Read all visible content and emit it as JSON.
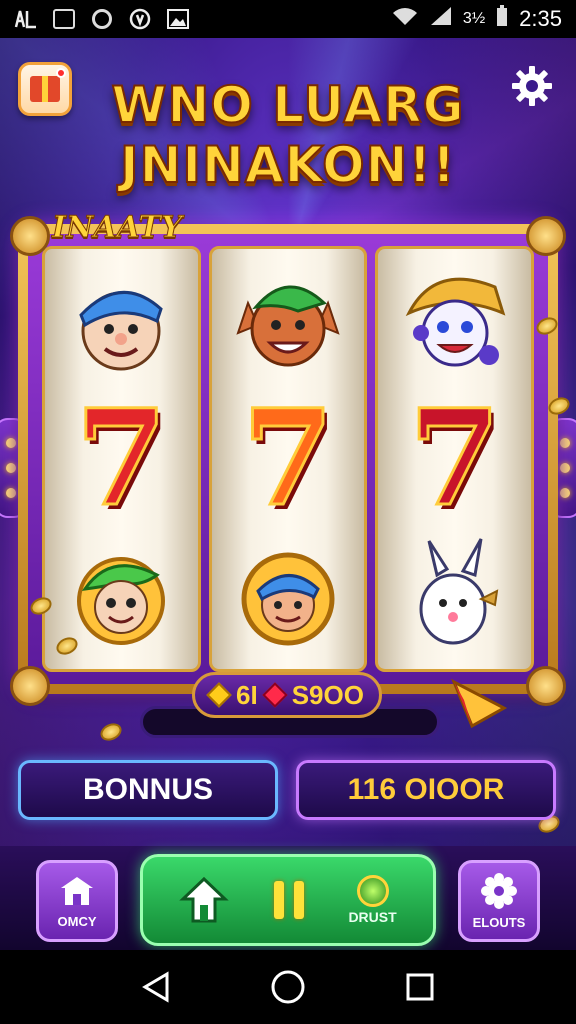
{
  "status_bar": {
    "left_icons": [
      "notification-icon",
      "gallery-icon",
      "circle-icon",
      "at-icon",
      "image-icon"
    ],
    "battery": "3½",
    "time": "2:35"
  },
  "header": {
    "title_line1": "WNO LUARG",
    "title_line2": "JNINAKON!!",
    "gift_icon": "gift-icon",
    "settings_icon": "gear-icon"
  },
  "machine": {
    "frame_label": "INAATY",
    "reels": [
      [
        "cap-face-symbol",
        "seven-symbol",
        "leaf-face-symbol"
      ],
      [
        "elf-face-symbol",
        "seven-symbol",
        "coin-face-symbol"
      ],
      [
        "jester-face-symbol",
        "seven-symbol",
        "bunny-symbol"
      ]
    ],
    "seven_glyph": "7",
    "win_plate": {
      "left_value": "6I",
      "right_value": "S9OO"
    }
  },
  "panels": {
    "bonus_label": "BONNUS",
    "amount_label": "116 OIOOR"
  },
  "controls": {
    "left_label": "OMCY",
    "right_label": "ELOUTS",
    "boost_label": "DRUST"
  },
  "colors": {
    "accent_gold": "#ffd43a",
    "frame_purple": "#7a34c8",
    "spin_green": "#2ab854",
    "bonus_blue": "#6ab8ff"
  }
}
